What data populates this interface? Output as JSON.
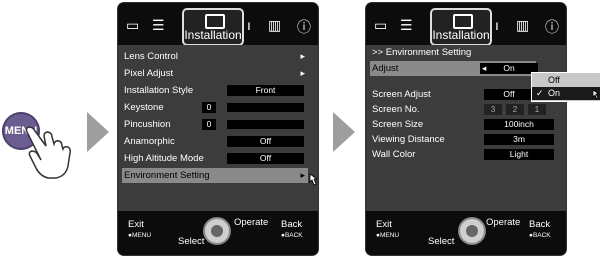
{
  "menu_button": {
    "label": "MENU"
  },
  "tabs": {
    "installation_label": "Installation"
  },
  "left_panel": {
    "items": [
      {
        "label": "Lens Control"
      },
      {
        "label": "Pixel Adjust"
      },
      {
        "label": "Installation Style",
        "value": "Front"
      },
      {
        "label": "Keystone",
        "value": "0"
      },
      {
        "label": "Pincushion",
        "value": "0"
      },
      {
        "label": "Anamorphic",
        "value": "Off"
      },
      {
        "label": "High Altitude Mode",
        "value": "Off"
      },
      {
        "label": "Environment Setting"
      }
    ]
  },
  "right_panel": {
    "breadcrumb": ">> Environment Setting",
    "adjust": {
      "label": "Adjust",
      "value": "On"
    },
    "dropdown": {
      "options": [
        "Off",
        "On"
      ],
      "selected": "On"
    },
    "items": [
      {
        "label": "Screen Adjust",
        "value": "Off"
      },
      {
        "label": "Screen No.",
        "options": [
          "3",
          "2",
          "1"
        ]
      },
      {
        "label": "Screen Size",
        "value": "100inch"
      },
      {
        "label": "Viewing Distance",
        "value": "3m"
      },
      {
        "label": "Wall Color",
        "value": "Light"
      }
    ]
  },
  "footer": {
    "exit": "Exit",
    "exit_sub": "MENU",
    "select": "Select",
    "operate": "Operate",
    "back": "Back",
    "back_sub": "BACK"
  }
}
